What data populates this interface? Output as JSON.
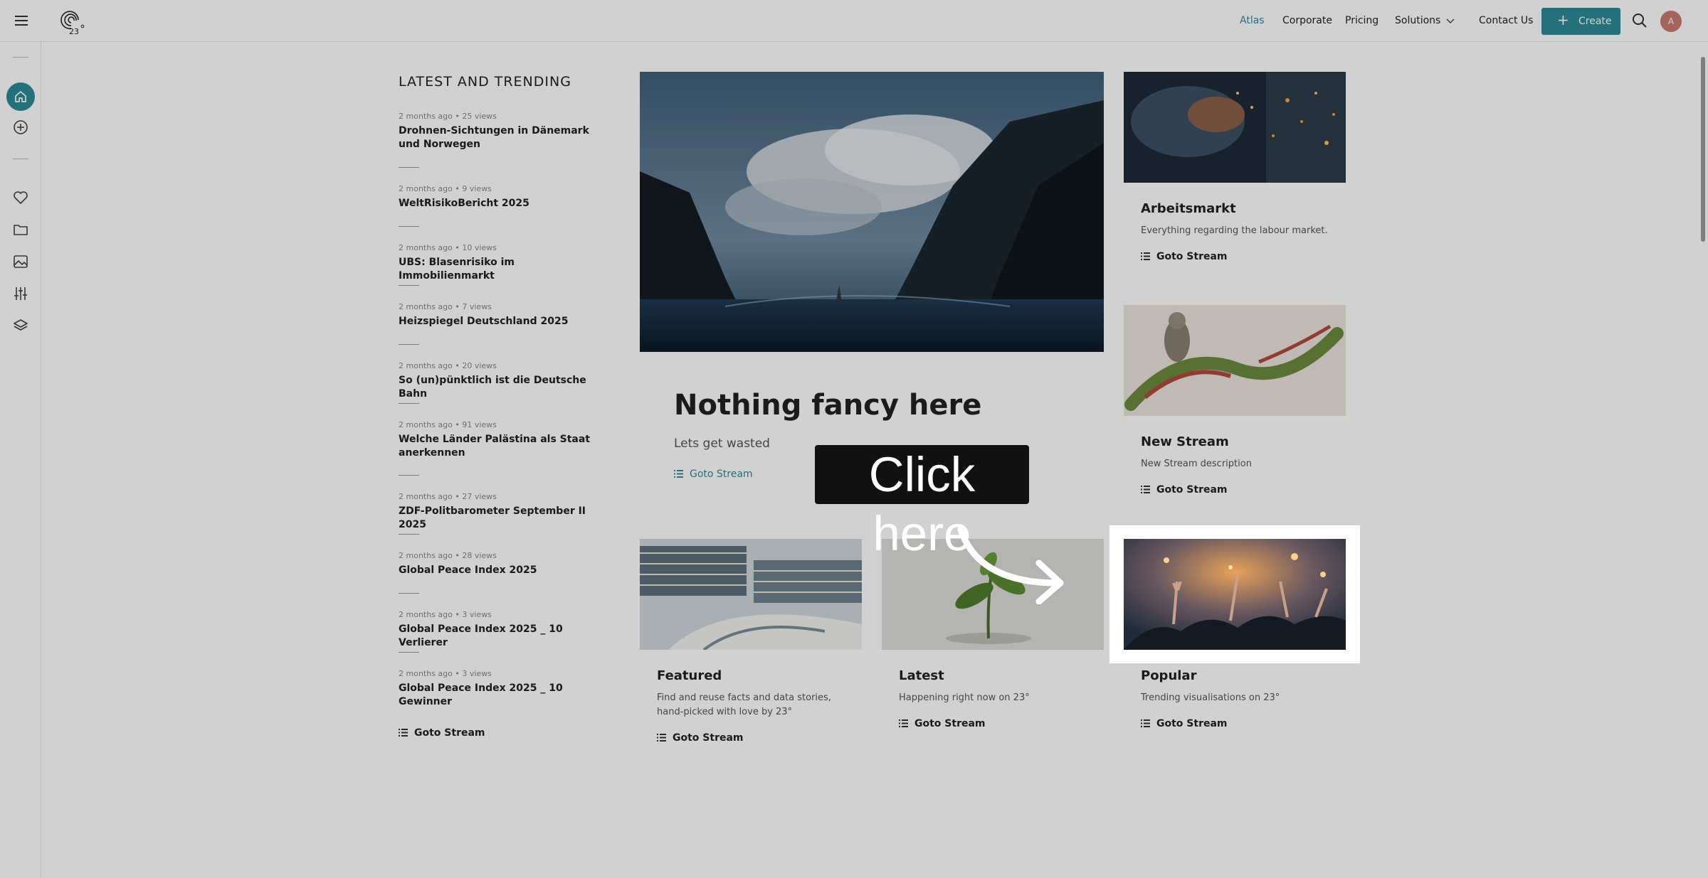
{
  "header": {
    "logo_text": "23°",
    "nav": [
      "Atlas",
      "Corporate",
      "Pricing",
      "Solutions",
      "Contact Us"
    ],
    "create_label": "Create",
    "avatar_initial": "A",
    "accent_color": "#2e8a97"
  },
  "sidebar": {
    "icons": [
      "home-icon",
      "add-circle-icon",
      "heart-icon",
      "folder-icon",
      "image-icon",
      "sliders-icon",
      "layers-icon"
    ]
  },
  "trending": {
    "title": "LATEST AND TRENDING",
    "items": [
      {
        "meta": "2 months ago • 25 views",
        "name": "Drohnen-Sichtungen in Dänemark und Norwegen"
      },
      {
        "meta": "2 months ago • 9 views",
        "name": "WeltRisikoBericht 2025"
      },
      {
        "meta": "2 months ago • 10 views",
        "name": "UBS: Blasenrisiko im Immobilienmarkt"
      },
      {
        "meta": "2 months ago • 7 views",
        "name": "Heizspiegel Deutschland 2025"
      },
      {
        "meta": "2 months ago • 20 views",
        "name": "So (un)pünktlich ist die Deutsche Bahn"
      },
      {
        "meta": "2 months ago • 91 views",
        "name": "Welche Länder Palästina als Staat anerkennen"
      },
      {
        "meta": "2 months ago • 27 views",
        "name": "ZDF-Politbarometer September II 2025"
      },
      {
        "meta": "2 months ago • 28 views",
        "name": "Global Peace Index 2025"
      },
      {
        "meta": "2 months ago • 3 views",
        "name": "Global Peace Index 2025 _ 10 Verlierer"
      },
      {
        "meta": "2 months ago • 3 views",
        "name": "Global Peace Index 2025 _ 10 Gewinner"
      }
    ],
    "goto": "Goto Stream"
  },
  "hero": {
    "title": "Nothing fancy here",
    "subtitle": "Lets get wasted",
    "goto": "Goto Stream"
  },
  "cards": {
    "arbeitsmarkt": {
      "title": "Arbeitsmarkt",
      "desc": "Everything regarding the labour market.",
      "goto": "Goto Stream"
    },
    "new_stream": {
      "title": "New Stream",
      "desc": "New Stream description",
      "goto": "Goto Stream"
    },
    "featured": {
      "title": "Featured",
      "desc": "Find and reuse facts and data stories, hand-picked with love by 23°",
      "goto": "Goto Stream"
    },
    "latest": {
      "title": "Latest",
      "desc": "Happening right now on 23°",
      "goto": "Goto Stream"
    },
    "popular": {
      "title": "Popular",
      "desc": "Trending visualisations on 23°",
      "goto": "Goto Stream"
    }
  },
  "overlay": {
    "tooltip": "Click here"
  }
}
